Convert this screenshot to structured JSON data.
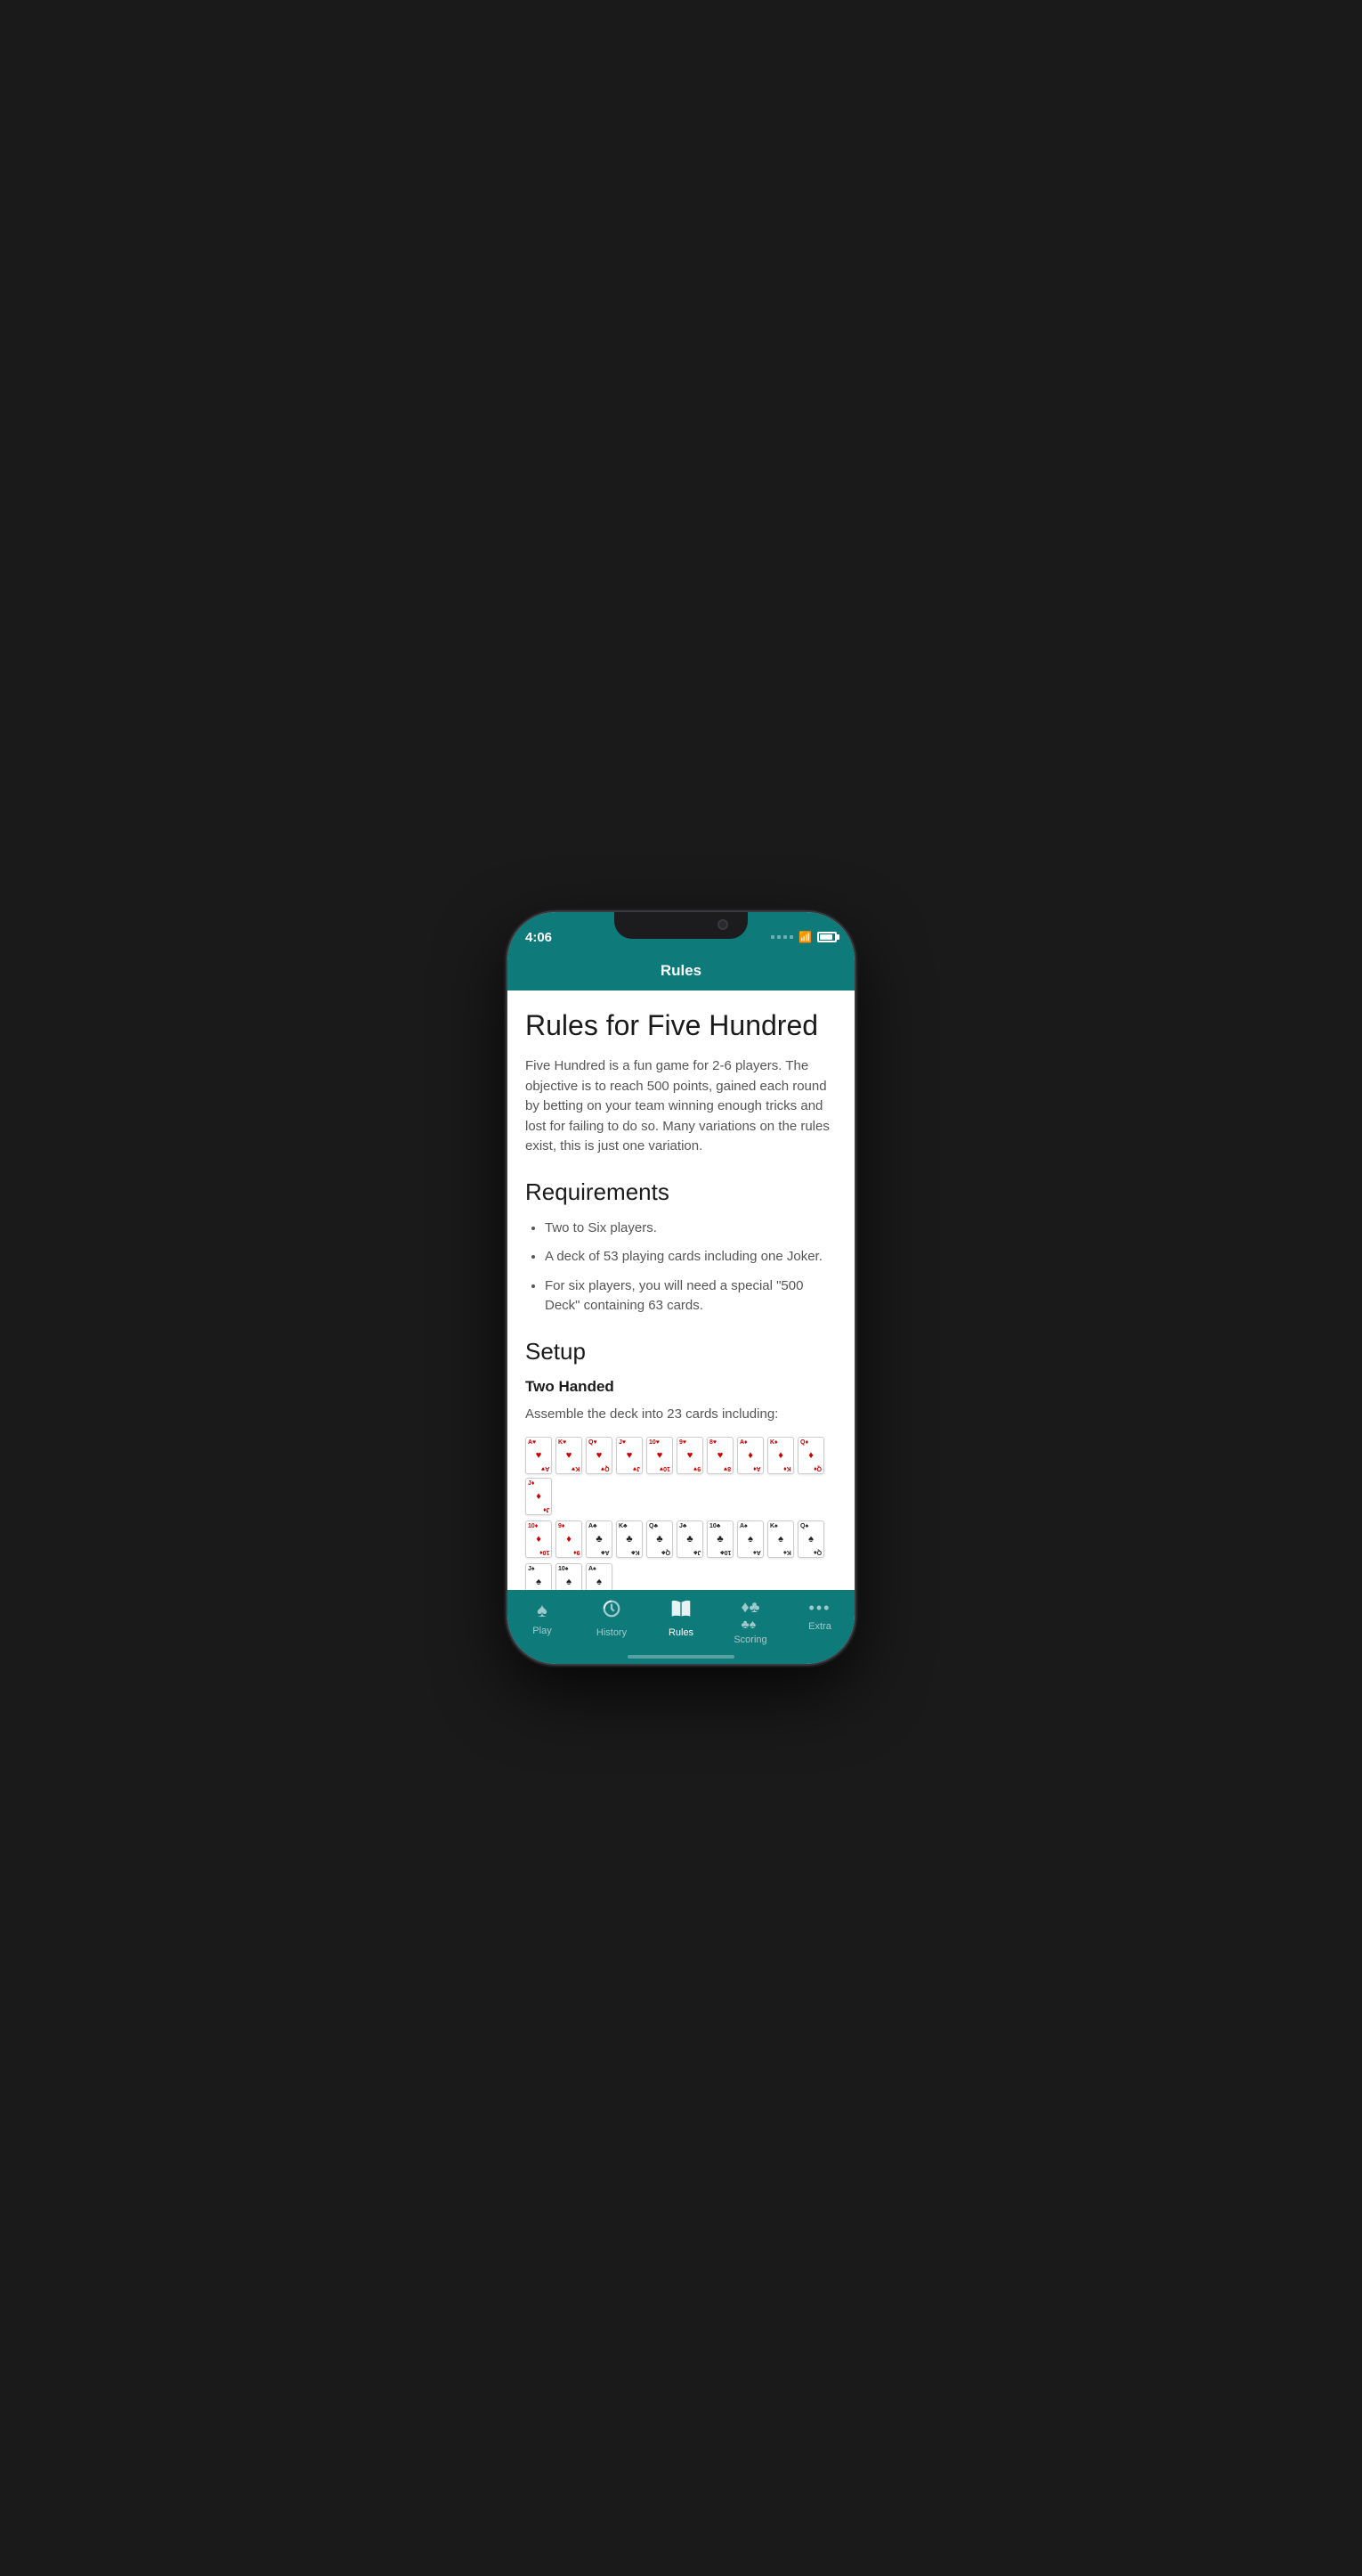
{
  "phone": {
    "time": "4:06",
    "nav_title": "Rules"
  },
  "content": {
    "page_title": "Rules for Five Hundred",
    "intro": "Five Hundred is a fun game for 2-6 players. The objective is to reach 500 points, gained each round by betting on your team winning enough tricks and lost for failing to do so. Many variations on the rules exist, this is just one variation.",
    "requirements_title": "Requirements",
    "requirements": [
      "Two to Six players.",
      "A deck of 53 playing cards including one Joker.",
      "For six players, you will need a special \"500 Deck\" containing 63 cards."
    ],
    "setup_title": "Setup",
    "setup_sub": "Two Handed",
    "setup_text": "Assemble the deck into 23 cards including:"
  },
  "tabs": [
    {
      "id": "play",
      "label": "Play",
      "icon": "♠",
      "active": false
    },
    {
      "id": "history",
      "label": "History",
      "icon": "⏱",
      "active": false
    },
    {
      "id": "rules",
      "label": "Rules",
      "icon": "📖",
      "active": true
    },
    {
      "id": "scoring",
      "label": "Scoring",
      "icon": "♦♣",
      "active": false
    },
    {
      "id": "extra",
      "label": "Extra",
      "icon": "•••",
      "active": false
    }
  ],
  "cards_row1": [
    {
      "rank": "A",
      "suit": "♥",
      "color": "red"
    },
    {
      "rank": "K",
      "suit": "♥",
      "color": "red"
    },
    {
      "rank": "Q",
      "suit": "♥",
      "color": "red"
    },
    {
      "rank": "J",
      "suit": "♥",
      "color": "red"
    },
    {
      "rank": "10",
      "suit": "♥",
      "color": "red"
    },
    {
      "rank": "9",
      "suit": "♥",
      "color": "red"
    },
    {
      "rank": "8",
      "suit": "♥",
      "color": "red"
    },
    {
      "rank": "A",
      "suit": "♦",
      "color": "red"
    },
    {
      "rank": "K",
      "suit": "♦",
      "color": "red"
    },
    {
      "rank": "Q",
      "suit": "♦",
      "color": "red"
    },
    {
      "rank": "J",
      "suit": "♦",
      "color": "red"
    }
  ],
  "cards_row2": [
    {
      "rank": "10",
      "suit": "♦",
      "color": "red"
    },
    {
      "rank": "9",
      "suit": "♦",
      "color": "red"
    },
    {
      "rank": "A",
      "suit": "♣",
      "color": "black"
    },
    {
      "rank": "K",
      "suit": "♣",
      "color": "black"
    },
    {
      "rank": "Q",
      "suit": "♣",
      "color": "black"
    },
    {
      "rank": "J",
      "suit": "♣",
      "color": "black"
    },
    {
      "rank": "10",
      "suit": "♣",
      "color": "black"
    },
    {
      "rank": "A",
      "suit": "♠",
      "color": "black"
    },
    {
      "rank": "K",
      "suit": "♠",
      "color": "black"
    },
    {
      "rank": "Q",
      "suit": "♠",
      "color": "black"
    }
  ],
  "cards_row3": [
    {
      "rank": "J",
      "suit": "♠",
      "color": "black"
    },
    {
      "rank": "10",
      "suit": "♠",
      "color": "black"
    },
    {
      "rank": "A",
      "suit": "♠",
      "color": "black"
    }
  ]
}
